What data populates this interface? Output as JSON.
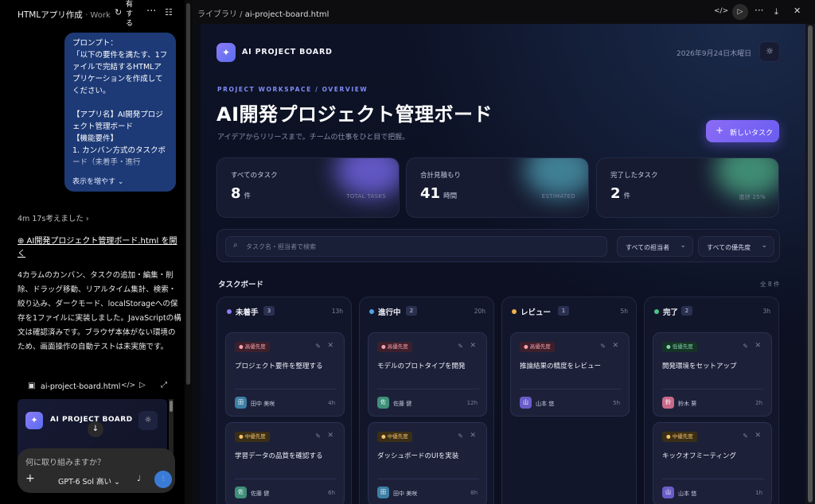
{
  "chat": {
    "title": "HTMLアプリ作成",
    "subtitle": "· Work",
    "share_popup": "有する",
    "prompt_text": "プロンプト：\n「以下の要件を満たす、1ファイルで完結するHTMLアプリケーションを作成してください。\n\n【アプリ名】AI開発プロジェクト管理ボード\n【機能要件】\n1. カンバン方式のタスクボード（未着手・進行",
    "show_more": "表示を増やす",
    "thinking": "4m 17s考えました",
    "file_link": "⊕ AI開発プロジェクト管理ボード.html を開く",
    "answer": "4カラムのカンバン、タスクの追加・編集・削除、ドラッグ移動、リアルタイム集計、検索・絞り込み、ダークモード、localStorageへの保存を1ファイルに実装しました。JavaScriptの構文は確認済みです。ブラウザ本体がない環境のため、画面操作の自動テストは未実施です。",
    "file_card_name": "ai-project-board.html",
    "preview_title": "AI PROJECT BOARD",
    "composer_placeholder": "何に取り組みますか？",
    "model_label": "GPT-6 Sol 高い"
  },
  "browser": {
    "breadcrumb_root": "ライブラリ /",
    "breadcrumb_file": "ai-project-board.html"
  },
  "app": {
    "brand": "AI PROJECT BOARD",
    "date": "2026年9月24日木曜日",
    "kicker": "PROJECT WORKSPACE / OVERVIEW",
    "title": "AI開発プロジェクト管理ボード",
    "lead": "アイデアからリリースまで。チームの仕事をひと目で把握。",
    "new_task": "新しいタスク",
    "stats": [
      {
        "label": "すべてのタスク",
        "value": "8",
        "unit": "件",
        "caption": "TOTAL TASKS",
        "glow": "#7b6cf6"
      },
      {
        "label": "合計見積もり",
        "value": "41",
        "unit": "時間",
        "caption": "ESTIMATED",
        "glow": "#4fa3b8"
      },
      {
        "label": "完了したタスク",
        "value": "2",
        "unit": "件",
        "caption": "進捗 25%",
        "glow": "#4fb38a"
      }
    ],
    "search_placeholder": "タスク名・担当者で検索",
    "assignee_filter": "すべての担当者",
    "priority_filter": "すべての優先度",
    "board_title": "タスクボード",
    "board_count": "全 8 件",
    "columns": [
      {
        "name": "未着手",
        "count": "3",
        "hours": "13h",
        "color": "#8b7cf6",
        "cards": [
          {
            "priority": "高優先度",
            "level": "high",
            "title": "プロジェクト要件を整理する",
            "avatar": "田",
            "avatar_color": "#3d7fa6",
            "assignee": "田中 美咲",
            "hours": "4h"
          },
          {
            "priority": "中優先度",
            "level": "mid",
            "title": "学習データの品質を確認する",
            "avatar": "佐",
            "avatar_color": "#3f8f7a",
            "assignee": "佐藤 健",
            "hours": "6h"
          }
        ]
      },
      {
        "name": "進行中",
        "count": "2",
        "hours": "20h",
        "color": "#4fa3e0",
        "cards": [
          {
            "priority": "高優先度",
            "level": "high",
            "title": "モデルのプロトタイプを開発",
            "avatar": "佐",
            "avatar_color": "#3f8f7a",
            "assignee": "佐藤 健",
            "hours": "12h"
          },
          {
            "priority": "中優先度",
            "level": "mid",
            "title": "ダッシュボードのUIを実装",
            "avatar": "田",
            "avatar_color": "#3d7fa6",
            "assignee": "田中 美咲",
            "hours": "8h"
          }
        ]
      },
      {
        "name": "レビュー",
        "count": "1",
        "hours": "5h",
        "color": "#f0b24a",
        "cards": [
          {
            "priority": "高優先度",
            "level": "high",
            "title": "推論結果の精度をレビュー",
            "avatar": "山",
            "avatar_color": "#6a5cc8",
            "assignee": "山本 悠",
            "hours": "5h"
          }
        ]
      },
      {
        "name": "完了",
        "count": "2",
        "hours": "3h",
        "color": "#4fc38a",
        "cards": [
          {
            "priority": "低優先度",
            "level": "low",
            "title": "開発環境をセットアップ",
            "avatar": "鈴",
            "avatar_color": "#c86a8a",
            "assignee": "鈴木 葵",
            "hours": "2h"
          },
          {
            "priority": "中優先度",
            "level": "mid",
            "title": "キックオフミーティング",
            "avatar": "山",
            "avatar_color": "#6a5cc8",
            "assignee": "山本 悠",
            "hours": "1h"
          }
        ]
      }
    ]
  }
}
